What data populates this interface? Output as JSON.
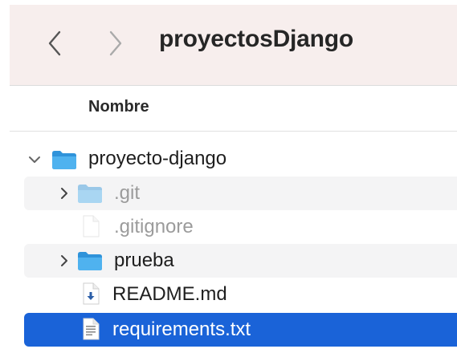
{
  "window": {
    "title": "proyectosDjango"
  },
  "columns": {
    "name": "Nombre"
  },
  "colors": {
    "folder": "#3aa4e8",
    "selection": "#1a63d8",
    "toolbar": "#f7eeed"
  },
  "files": [
    {
      "name": "proyecto-django",
      "kind": "folder",
      "icon": "folder-icon",
      "expanded": true,
      "dimmed": false
    },
    {
      "name": ".git",
      "kind": "folder",
      "icon": "folder-icon",
      "expanded": false,
      "dimmed": true
    },
    {
      "name": ".gitignore",
      "kind": "file",
      "icon": "blank-document-icon",
      "dimmed": true
    },
    {
      "name": "prueba",
      "kind": "folder",
      "icon": "folder-icon",
      "expanded": false,
      "dimmed": false
    },
    {
      "name": "README.md",
      "kind": "file",
      "icon": "markdown-document-icon",
      "dimmed": false
    },
    {
      "name": "requirements.txt",
      "kind": "file",
      "icon": "text-document-icon",
      "dimmed": false,
      "selected": true
    }
  ]
}
